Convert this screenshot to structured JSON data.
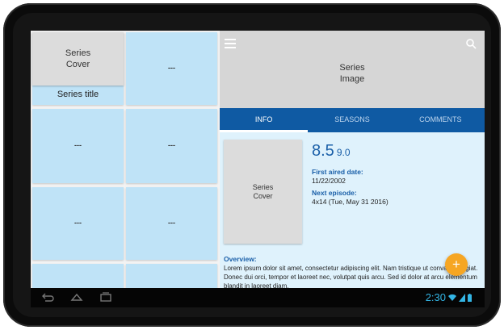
{
  "grid": {
    "first_tile": {
      "cover_label": "Series\nCover",
      "title": "Series title"
    },
    "placeholder": "---",
    "rows": 4
  },
  "detail": {
    "hero_label": "Series\nImage",
    "tabs": [
      {
        "label": "INFO",
        "active": true
      },
      {
        "label": "SEASONS",
        "active": false
      },
      {
        "label": "COMMENTS",
        "active": false
      }
    ],
    "cover_label": "Series\nCover",
    "rating": {
      "main": "8.5",
      "secondary": "9.0"
    },
    "first_aired_label": "First aired date:",
    "first_aired_value": "11/22/2002",
    "next_episode_label": "Next episode:",
    "next_episode_value": "4x14 (Tue, May 31 2016)",
    "overview_label": "Overview:",
    "overview_text": "Lorem ipsum dolor sit amet, consectetur adipiscing elit. Nam tristique ut convallis feugiat. Donec dui orci, tempor et laoreet nec, volutpat quis arcu. Sed id dolor at arcu elementum blandit in laoreet diam."
  },
  "fab": {
    "label": "+"
  },
  "status_bar": {
    "time": "2:30"
  },
  "colors": {
    "tile": "#bfe3f7",
    "tabs": "#0f5aa3",
    "accent_text": "#1a5fa8",
    "fab": "#f6a623",
    "status": "#33b5e5"
  }
}
